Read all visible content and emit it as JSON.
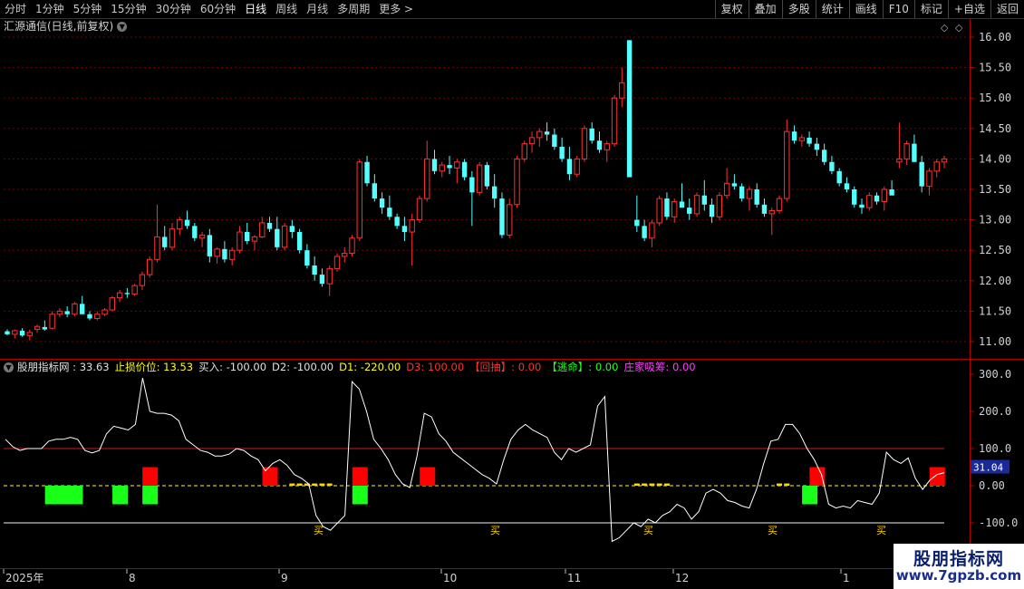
{
  "toolbar": {
    "periods": [
      "分时",
      "1分钟",
      "5分钟",
      "15分钟",
      "30分钟",
      "60分钟",
      "日线",
      "周线",
      "月线",
      "多周期",
      "更多 >"
    ],
    "active_period": "日线",
    "buttons": [
      "复权",
      "叠加",
      "多股",
      "统计",
      "画线",
      "F10",
      "标记",
      "+自选",
      "返回"
    ]
  },
  "main": {
    "title": "汇源通信(日线,前复权)",
    "price_axis": [
      "16.00",
      "15.50",
      "15.00",
      "14.50",
      "14.00",
      "13.50",
      "13.00",
      "12.50",
      "12.00",
      "11.50",
      "11.00"
    ]
  },
  "indicator": {
    "name": "股朋指标网",
    "items": [
      {
        "label": "股朋指标网 : ",
        "value": "33.63",
        "color": "#e0e0e0"
      },
      {
        "label": "止损价位: ",
        "value": "13.53",
        "color": "#ffff00"
      },
      {
        "label": "买入: ",
        "value": "-100.00",
        "color": "#e0e0e0"
      },
      {
        "label": "D2: ",
        "value": "-100.00",
        "color": "#e0e0e0"
      },
      {
        "label": "D1: ",
        "value": "-220.00",
        "color": "#ffff00"
      },
      {
        "label": "D3: ",
        "value": "100.00",
        "color": "#ff3030"
      },
      {
        "label": "【回抽】: ",
        "value": "0.00",
        "color": "#ff3030"
      },
      {
        "label": "【逃命】: ",
        "value": "0.00",
        "color": "#22ff22"
      },
      {
        "label": "庄家吸筹: ",
        "value": "0.00",
        "color": "#ff40ff"
      }
    ],
    "axis": [
      "300.0",
      "200.0",
      "100.0",
      "0.00",
      "-100.0"
    ],
    "current_value": "31.04",
    "buy_marks": [
      "买",
      "买",
      "买",
      "买",
      "买"
    ]
  },
  "time_axis": [
    "2025年",
    "8",
    "9",
    "10",
    "11",
    "12",
    "1"
  ],
  "watermark": {
    "line1": "股朋指标网",
    "line2": "www.7gpzb.com"
  },
  "colors": {
    "up": "#ff3030",
    "down": "#54ffff",
    "grid": "#7a0000",
    "axis_red": "#b00000",
    "ind_line": "#ffffff",
    "ref_line": "#ffffff",
    "stop_line": "#ffff00",
    "red_block": "#ff0000",
    "green_block": "#19ff19"
  }
}
